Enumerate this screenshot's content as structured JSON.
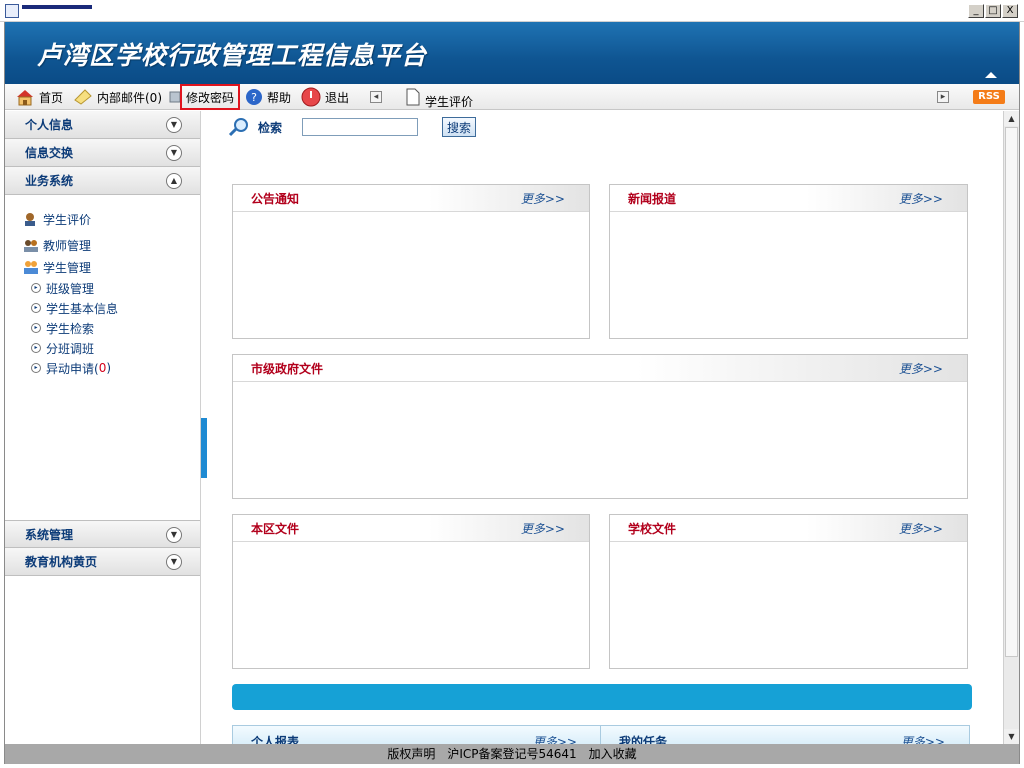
{
  "window": {
    "minimize": "_",
    "maximize": "□",
    "close": "X"
  },
  "banner": {
    "title": "卢湾区学校行政管理工程信息平台"
  },
  "toolbar": {
    "home": "首页",
    "mail": "内部邮件(0)",
    "change_password": "修改密码",
    "help": "帮助",
    "exit": "退出",
    "student_eval": "学生评价",
    "rss": "RSS"
  },
  "sidebar": {
    "sections_top": [
      {
        "label": "个人信息"
      },
      {
        "label": "信息交换"
      },
      {
        "label": "业务系统"
      }
    ],
    "items": [
      {
        "label": "学生评价"
      },
      {
        "label": "教师管理"
      },
      {
        "label": "学生管理"
      }
    ],
    "subitems": [
      {
        "label": "班级管理"
      },
      {
        "label": "学生基本信息"
      },
      {
        "label": "学生检索"
      },
      {
        "label": "分班调班"
      },
      {
        "label": "异动申请(",
        "count": "0",
        "suffix": ")"
      }
    ],
    "sections_bottom": [
      {
        "label": "系统管理"
      },
      {
        "label": "教育机构黄页"
      }
    ]
  },
  "search": {
    "label": "检索",
    "button": "搜索",
    "value": ""
  },
  "panels": {
    "notice": {
      "title": "公告通知",
      "more": "更多>>"
    },
    "news": {
      "title": "新闻报道",
      "more": "更多>>"
    },
    "city": {
      "title": "市级政府文件",
      "more": "更多>>"
    },
    "district": {
      "title": "本区文件",
      "more": "更多>>"
    },
    "school": {
      "title": "学校文件",
      "more": "更多>>"
    },
    "report": {
      "title": "个人报表",
      "more": "更多>>"
    },
    "tasks": {
      "title": "我的任务",
      "more": "更多>>"
    }
  },
  "footer": {
    "copyright": "版权声明",
    "icp": "沪ICP备案登记号54641",
    "favorite": "加入收藏"
  },
  "colors": {
    "banner": "#0f5592",
    "highlight": "#e0141e",
    "panel_title": "#b2001c",
    "link": "#0c3b78"
  }
}
